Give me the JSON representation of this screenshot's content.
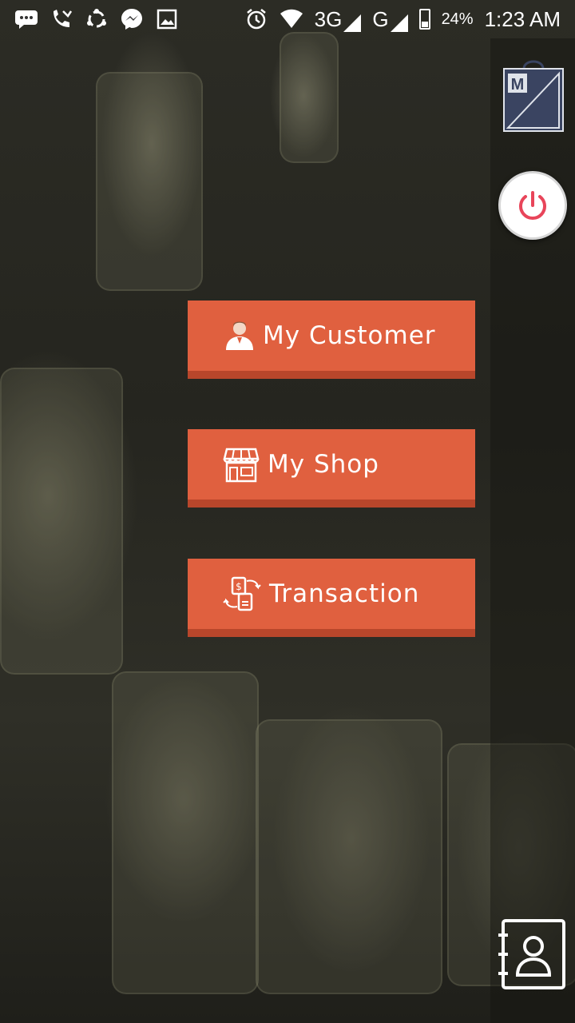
{
  "status_bar": {
    "network_3g": "3G",
    "network_g": "G",
    "battery": "24%",
    "time": "1:23 AM",
    "icons": [
      "message-icon",
      "missed-call-icon",
      "sync-icon",
      "messenger-icon",
      "image-icon",
      "alarm-icon",
      "wifi-icon",
      "signal-icon",
      "battery-icon"
    ]
  },
  "sidebar": {
    "logo_letter": "M",
    "logo_icon": "shop-bag-logo-icon",
    "power_icon": "power-icon",
    "contacts_icon": "contact-book-icon"
  },
  "menu": {
    "customer_label": "My Customer",
    "shop_label": "My Shop",
    "transaction_label": "Transaction"
  },
  "colors": {
    "button": "#e0603f",
    "button_shadow": "#b8462b",
    "power_red": "#e8455a",
    "logo_navy": "#3a4461"
  }
}
